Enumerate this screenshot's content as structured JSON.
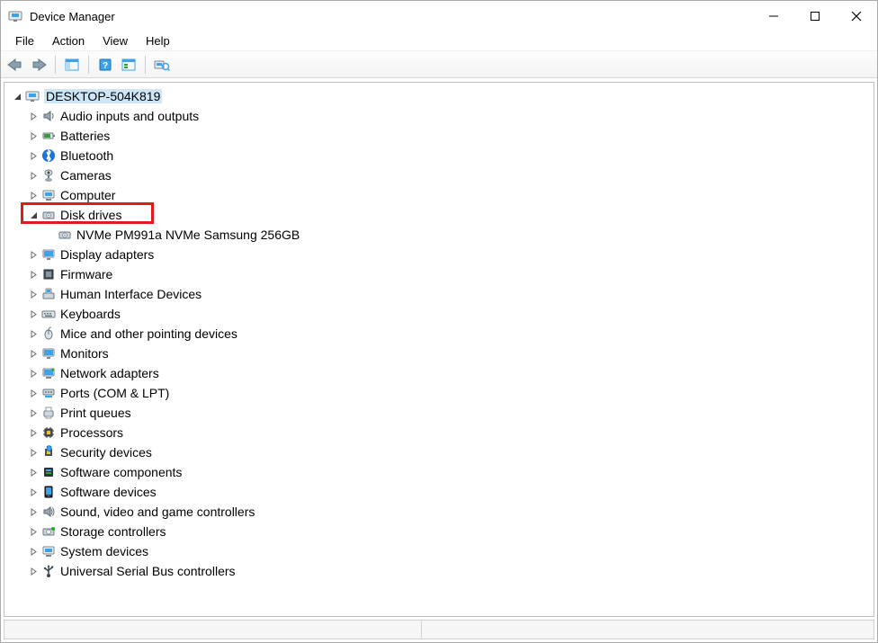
{
  "window": {
    "title": "Device Manager"
  },
  "menu": {
    "file": "File",
    "action": "Action",
    "view": "View",
    "help": "Help"
  },
  "tree": {
    "root": {
      "label": "DESKTOP-504K819",
      "expanded": true,
      "selected": true,
      "nodes": [
        {
          "id": "audio",
          "label": "Audio inputs and outputs",
          "expanded": false
        },
        {
          "id": "batteries",
          "label": "Batteries",
          "expanded": false
        },
        {
          "id": "bluetooth",
          "label": "Bluetooth",
          "expanded": false
        },
        {
          "id": "cameras",
          "label": "Cameras",
          "expanded": false
        },
        {
          "id": "computer",
          "label": "Computer",
          "expanded": false
        },
        {
          "id": "disk",
          "label": "Disk drives",
          "expanded": true,
          "highlighted": true,
          "children": [
            {
              "id": "disk0",
              "label": "NVMe PM991a NVMe Samsung 256GB"
            }
          ]
        },
        {
          "id": "display",
          "label": "Display adapters",
          "expanded": false
        },
        {
          "id": "firmware",
          "label": "Firmware",
          "expanded": false
        },
        {
          "id": "hid",
          "label": "Human Interface Devices",
          "expanded": false
        },
        {
          "id": "keyboards",
          "label": "Keyboards",
          "expanded": false
        },
        {
          "id": "mice",
          "label": "Mice and other pointing devices",
          "expanded": false
        },
        {
          "id": "monitors",
          "label": "Monitors",
          "expanded": false
        },
        {
          "id": "network",
          "label": "Network adapters",
          "expanded": false
        },
        {
          "id": "ports",
          "label": "Ports (COM & LPT)",
          "expanded": false
        },
        {
          "id": "printq",
          "label": "Print queues",
          "expanded": false
        },
        {
          "id": "processors",
          "label": "Processors",
          "expanded": false
        },
        {
          "id": "security",
          "label": "Security devices",
          "expanded": false
        },
        {
          "id": "swcomp",
          "label": "Software components",
          "expanded": false
        },
        {
          "id": "swdev",
          "label": "Software devices",
          "expanded": false
        },
        {
          "id": "sound",
          "label": "Sound, video and game controllers",
          "expanded": false
        },
        {
          "id": "storage",
          "label": "Storage controllers",
          "expanded": false
        },
        {
          "id": "system",
          "label": "System devices",
          "expanded": false
        },
        {
          "id": "usb",
          "label": "Universal Serial Bus controllers",
          "expanded": false
        }
      ]
    }
  }
}
